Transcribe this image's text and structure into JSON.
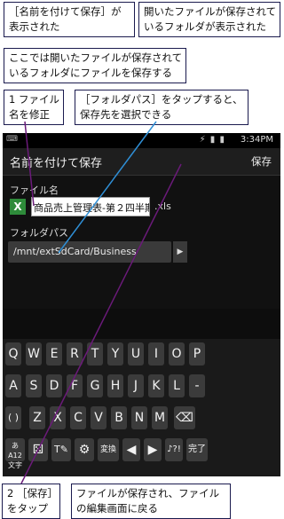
{
  "callouts": {
    "top_left": [
      "［名前を付けて保存］が",
      "表示された"
    ],
    "top_right": [
      "開いたファイルが保存されて",
      "いるフォルダが表示された"
    ],
    "middle": [
      "ここでは開いたファイルが保存されて",
      "いるフォルダにファイルを保存する"
    ],
    "step1": [
      "1 ファイル",
      "名を修正"
    ],
    "folder_path_note": [
      "［フォルダパス］をタップすると、",
      "保存先を選択できる"
    ],
    "step2": [
      "2 ［保存］",
      "をタップ"
    ],
    "bottom_result": [
      "ファイルが保存され、ファイル",
      "の編集画面に戻る"
    ]
  },
  "status_bar": {
    "time": "3:34PM",
    "icons": "⚡ ▮ ▮"
  },
  "action_bar": {
    "title": "名前を付けて保存",
    "save_label": "保存"
  },
  "form": {
    "file_name_label": "ファイル名",
    "file_name_value": "商品売上管理表-第２四半期",
    "file_icon": "X",
    "extension": ".xls",
    "folder_path_label": "フォルダパス",
    "folder_path_value": "/mnt/extSdCard/Business"
  },
  "keyboard": {
    "row1": [
      "Q",
      "W",
      "E",
      "R",
      "T",
      "Y",
      "U",
      "I",
      "O",
      "P"
    ],
    "row2": [
      "A",
      "S",
      "D",
      "F",
      "G",
      "H",
      "J",
      "K",
      "L",
      "-"
    ],
    "row3": [
      "( )",
      "Z",
      "X",
      "C",
      "V",
      "B",
      "N",
      "M",
      "⌫"
    ],
    "row4": [
      "あA12 文字",
      "⚄",
      "T✎",
      "⚙",
      "変換",
      "◀",
      "▶",
      "♪?!",
      "完了"
    ]
  },
  "colors": {
    "annotation_line_purple": "#6b1a7a",
    "annotation_line_blue": "#2f8fd6"
  }
}
